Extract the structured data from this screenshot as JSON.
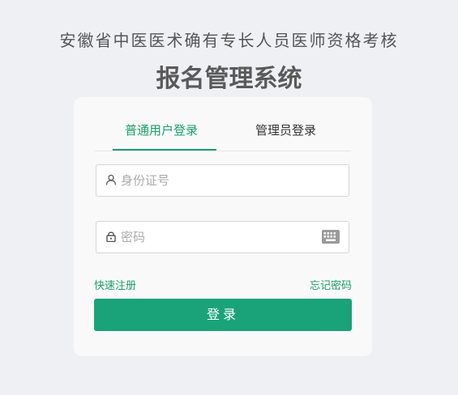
{
  "header": {
    "subtitle": "安徽省中医医术确有专长人员医师资格考核",
    "title": "报名管理系统"
  },
  "tabs": [
    {
      "label": "普通用户登录",
      "active": true
    },
    {
      "label": "管理员登录",
      "active": false
    }
  ],
  "form": {
    "id_placeholder": "身份证号",
    "password_placeholder": "密码",
    "register_link": "快速注册",
    "forgot_link": "忘记密码",
    "login_label": "登录"
  },
  "colors": {
    "accent": "#1a9e6a",
    "button": "#1aa378"
  },
  "icons": [
    "user-icon",
    "lock-icon",
    "keyboard-icon"
  ]
}
